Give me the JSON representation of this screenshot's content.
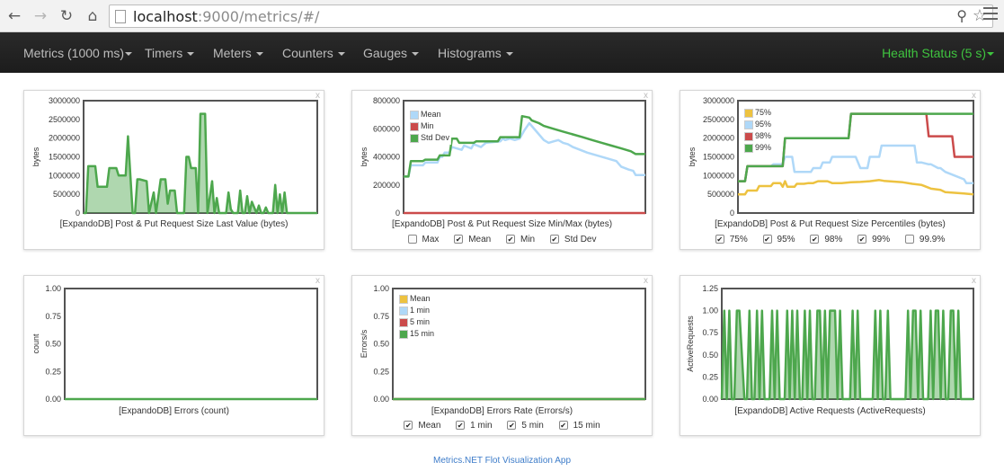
{
  "browser": {
    "back_icon": "back-arrow-icon",
    "forward_icon": "forward-arrow-icon",
    "reload_icon": "reload-icon",
    "home_icon": "home-icon",
    "url_host": "localhost",
    "url_rest": ":9000/metrics/#/",
    "zoom_icon": "zoom-icon",
    "star_icon": "bookmark-star-icon",
    "menu_icon": "menu-icon"
  },
  "navbar": {
    "items": [
      {
        "label": "Metrics (1000 ms)"
      },
      {
        "label": "Timers"
      },
      {
        "label": "Meters"
      },
      {
        "label": "Counters"
      },
      {
        "label": "Gauges"
      },
      {
        "label": "Histograms"
      }
    ],
    "health_label": "Health Status (5 s)",
    "health_color": "#3fc43f",
    "background": "#222222"
  },
  "panels": [
    {
      "close_label": "x",
      "caption": "[ExpandoDB] Post & Put Request Size Last Value (bytes)",
      "ylabel": "bytes",
      "legend": [],
      "toggles": []
    },
    {
      "close_label": "x",
      "caption": "[ExpandoDB] Post & Put Request Size Min/Max (bytes)",
      "ylabel": "bytes",
      "legend": [
        {
          "label": "Mean",
          "color": "#afd8f8"
        },
        {
          "label": "Min",
          "color": "#cb4b4b"
        },
        {
          "label": "Std Dev",
          "color": "#4da74d"
        }
      ],
      "toggles": [
        {
          "label": "Max",
          "checked": false
        },
        {
          "label": "Mean",
          "checked": true
        },
        {
          "label": "Min",
          "checked": true
        },
        {
          "label": "Std Dev",
          "checked": true
        }
      ]
    },
    {
      "close_label": "x",
      "caption": "[ExpandoDB] Post & Put Request Size Percentiles (bytes)",
      "ylabel": "bytes",
      "legend": [
        {
          "label": "75%",
          "color": "#edc240"
        },
        {
          "label": "95%",
          "color": "#afd8f8"
        },
        {
          "label": "98%",
          "color": "#cb4b4b"
        },
        {
          "label": "99%",
          "color": "#4da74d"
        }
      ],
      "toggles": [
        {
          "label": "75%",
          "checked": true
        },
        {
          "label": "95%",
          "checked": true
        },
        {
          "label": "98%",
          "checked": true
        },
        {
          "label": "99%",
          "checked": true
        },
        {
          "label": "99.9%",
          "checked": false
        }
      ]
    },
    {
      "close_label": "x",
      "caption": "[ExpandoDB] Errors (count)",
      "ylabel": "count",
      "legend": [],
      "toggles": []
    },
    {
      "close_label": "x",
      "caption": "[ExpandoDB] Errors Rate (Errors/s)",
      "ylabel": "Errors/s",
      "legend": [
        {
          "label": "Mean",
          "color": "#edc240"
        },
        {
          "label": "1 min",
          "color": "#afd8f8"
        },
        {
          "label": "5 min",
          "color": "#cb4b4b"
        },
        {
          "label": "15 min",
          "color": "#4da74d"
        }
      ],
      "toggles": [
        {
          "label": "Mean",
          "checked": true
        },
        {
          "label": "1 min",
          "checked": true
        },
        {
          "label": "5 min",
          "checked": true
        },
        {
          "label": "15 min",
          "checked": true
        }
      ]
    },
    {
      "close_label": "x",
      "caption": "[ExpandoDB] Active Requests (ActiveRequests)",
      "ylabel": "ActiveRequests",
      "legend": [],
      "toggles": []
    }
  ],
  "chart_data": [
    {
      "type": "area",
      "title": "[ExpandoDB] Post & Put Request Size Last Value (bytes)",
      "ylabel": "bytes",
      "ylim": [
        0,
        3000000
      ],
      "yticks": [
        "0",
        "500000",
        "1000000",
        "1500000",
        "2000000",
        "2500000",
        "3000000"
      ],
      "xlim": [
        0,
        100
      ],
      "series": [
        {
          "color": "#4da74d",
          "fill": true,
          "x": [
            0,
            1,
            2,
            5,
            6,
            10,
            11,
            14,
            15,
            18,
            19,
            21,
            22,
            23,
            24,
            27,
            28,
            30,
            31,
            33,
            35,
            36,
            37,
            39,
            40,
            42,
            43,
            44,
            45,
            46,
            48,
            49,
            50,
            52,
            53,
            55,
            56,
            57,
            58,
            61,
            62,
            63,
            64,
            66,
            67,
            68,
            69,
            70,
            71,
            72,
            74,
            75,
            76,
            77,
            78,
            79,
            80,
            81,
            82,
            83,
            84,
            85,
            86,
            87,
            88,
            90,
            91,
            92,
            93,
            94,
            96,
            97,
            98,
            99,
            100
          ],
          "y": [
            0,
            0,
            1250000,
            1250000,
            700000,
            700000,
            1200000,
            1200000,
            1000000,
            1000000,
            2050000,
            0,
            0,
            900000,
            900000,
            850000,
            0,
            550000,
            0,
            900000,
            900000,
            250000,
            600000,
            600000,
            0,
            0,
            0,
            1500000,
            1500000,
            1200000,
            1200000,
            0,
            2650000,
            2650000,
            0,
            850000,
            0,
            400000,
            0,
            0,
            550000,
            100000,
            0,
            0,
            600000,
            0,
            0,
            450000,
            0,
            300000,
            0,
            200000,
            0,
            0,
            150000,
            0,
            0,
            0,
            750000,
            0,
            500000,
            0,
            550000,
            0,
            0,
            0,
            0,
            0,
            0,
            0,
            0,
            0,
            0,
            0,
            0
          ]
        }
      ]
    },
    {
      "type": "line",
      "title": "[ExpandoDB] Post & Put Request Size Min/Max (bytes)",
      "ylabel": "bytes",
      "ylim": [
        0,
        800000
      ],
      "yticks": [
        "0",
        "200000",
        "400000",
        "600000",
        "800000"
      ],
      "xlim": [
        0,
        100
      ],
      "series": [
        {
          "name": "Mean",
          "color": "#afd8f8",
          "x": [
            0,
            2,
            3,
            8,
            9,
            14,
            15,
            16,
            17,
            19,
            20,
            24,
            25,
            28,
            29,
            32,
            34,
            40,
            41,
            42,
            44,
            46,
            48,
            50,
            52,
            56,
            58,
            60,
            62,
            64,
            66,
            68,
            70,
            73,
            76,
            80,
            84,
            88,
            90,
            93,
            95,
            96,
            98,
            100
          ],
          "y": [
            260000,
            260000,
            340000,
            340000,
            360000,
            360000,
            400000,
            400000,
            430000,
            430000,
            470000,
            450000,
            480000,
            460000,
            490000,
            470000,
            500000,
            510000,
            530000,
            520000,
            530000,
            520000,
            530000,
            590000,
            640000,
            560000,
            520000,
            500000,
            510000,
            520000,
            500000,
            490000,
            470000,
            450000,
            430000,
            410000,
            390000,
            370000,
            330000,
            310000,
            300000,
            270000,
            270000,
            270000
          ]
        },
        {
          "name": "Min",
          "color": "#cb4b4b",
          "x": [
            0,
            100
          ],
          "y": [
            0,
            0
          ]
        },
        {
          "name": "Std Dev",
          "color": "#4da74d",
          "x": [
            0,
            2,
            3,
            8,
            9,
            14,
            15,
            19,
            20,
            22,
            23,
            29,
            30,
            39,
            40,
            48,
            49,
            52,
            53,
            56,
            58,
            62,
            66,
            70,
            74,
            78,
            82,
            86,
            90,
            94,
            96,
            100
          ],
          "y": [
            260000,
            260000,
            370000,
            370000,
            380000,
            380000,
            410000,
            410000,
            530000,
            530000,
            500000,
            500000,
            510000,
            510000,
            540000,
            540000,
            690000,
            680000,
            660000,
            640000,
            620000,
            600000,
            580000,
            560000,
            540000,
            520000,
            500000,
            480000,
            460000,
            440000,
            420000,
            420000
          ]
        }
      ]
    },
    {
      "type": "line",
      "title": "[ExpandoDB] Post & Put Request Size Percentiles (bytes)",
      "ylabel": "bytes",
      "ylim": [
        0,
        3000000
      ],
      "yticks": [
        "0",
        "500000",
        "1000000",
        "1500000",
        "2000000",
        "2500000",
        "3000000"
      ],
      "xlim": [
        0,
        100
      ],
      "series": [
        {
          "name": "75%",
          "color": "#edc240",
          "x": [
            0,
            3,
            4,
            8,
            9,
            14,
            15,
            18,
            19,
            20,
            21,
            24,
            25,
            28,
            30,
            32,
            34,
            38,
            40,
            44,
            48,
            52,
            56,
            60,
            62,
            66,
            70,
            74,
            78,
            80,
            82,
            86,
            88,
            92,
            96,
            100
          ],
          "y": [
            500000,
            500000,
            600000,
            600000,
            720000,
            720000,
            800000,
            800000,
            700000,
            850000,
            700000,
            700000,
            780000,
            780000,
            800000,
            800000,
            850000,
            850000,
            800000,
            800000,
            820000,
            830000,
            850000,
            880000,
            860000,
            840000,
            820000,
            780000,
            750000,
            700000,
            650000,
            620000,
            560000,
            540000,
            520000,
            500000
          ]
        },
        {
          "name": "95%",
          "color": "#afd8f8",
          "x": [
            0,
            3,
            4,
            14,
            15,
            19,
            20,
            23,
            24,
            31,
            32,
            35,
            36,
            39,
            40,
            48,
            50,
            52,
            55,
            56,
            60,
            61,
            75,
            76,
            78,
            81,
            82,
            85,
            86,
            88,
            92,
            96,
            97,
            100
          ],
          "y": [
            850000,
            850000,
            1250000,
            1250000,
            1300000,
            1300000,
            1500000,
            1500000,
            1100000,
            1100000,
            1200000,
            1200000,
            1350000,
            1350000,
            1500000,
            1500000,
            1500000,
            1200000,
            1200000,
            1500000,
            1500000,
            1800000,
            1800000,
            1350000,
            1350000,
            1300000,
            1300000,
            1200000,
            1200000,
            1100000,
            1000000,
            900000,
            800000,
            800000
          ]
        },
        {
          "name": "98%",
          "color": "#cb4b4b",
          "x": [
            0,
            3,
            4,
            19,
            20,
            47,
            48,
            80,
            81,
            91,
            92,
            100
          ],
          "y": [
            850000,
            850000,
            1250000,
            1250000,
            2000000,
            2000000,
            2650000,
            2650000,
            2050000,
            2050000,
            1500000,
            1500000
          ]
        },
        {
          "name": "99%",
          "color": "#4da74d",
          "x": [
            0,
            3,
            4,
            19,
            20,
            47,
            48,
            100
          ],
          "y": [
            850000,
            850000,
            1250000,
            1250000,
            2000000,
            2000000,
            2650000,
            2650000
          ]
        }
      ]
    },
    {
      "type": "line",
      "title": "[ExpandoDB] Errors (count)",
      "ylabel": "count",
      "ylim": [
        0,
        1
      ],
      "yticks": [
        "0.00",
        "0.25",
        "0.50",
        "0.75",
        "1.00"
      ],
      "xlim": [
        0,
        100
      ],
      "series": [
        {
          "color": "#4da74d",
          "x": [
            0,
            100
          ],
          "y": [
            0,
            0
          ]
        }
      ]
    },
    {
      "type": "line",
      "title": "[ExpandoDB] Errors Rate (Errors/s)",
      "ylabel": "Errors/s",
      "ylim": [
        0,
        1
      ],
      "yticks": [
        "0.00",
        "0.25",
        "0.50",
        "0.75",
        "1.00"
      ],
      "xlim": [
        0,
        100
      ],
      "series": [
        {
          "name": "Mean",
          "color": "#edc240",
          "x": [
            0,
            100
          ],
          "y": [
            0,
            0
          ]
        },
        {
          "name": "1 min",
          "color": "#afd8f8",
          "x": [
            0,
            100
          ],
          "y": [
            0,
            0
          ]
        },
        {
          "name": "5 min",
          "color": "#cb4b4b",
          "x": [
            0,
            100
          ],
          "y": [
            0,
            0
          ]
        },
        {
          "name": "15 min",
          "color": "#4da74d",
          "x": [
            0,
            100
          ],
          "y": [
            0,
            0
          ]
        }
      ]
    },
    {
      "type": "area",
      "title": "[ExpandoDB] Active Requests (ActiveRequests)",
      "ylabel": "ActiveRequests",
      "ylim": [
        0,
        1.25
      ],
      "yticks": [
        "0.00",
        "0.25",
        "0.50",
        "0.75",
        "1.00",
        "1.25"
      ],
      "xlim": [
        0,
        100
      ],
      "series": [
        {
          "color": "#4da74d",
          "fill": true,
          "x": [
            0,
            1,
            2,
            3,
            4,
            5,
            6,
            7,
            9,
            10,
            11,
            12,
            13,
            14,
            15,
            16,
            17,
            19,
            20,
            21,
            22,
            23,
            24,
            25,
            26,
            27,
            28,
            29,
            30,
            31,
            32,
            33,
            34,
            35,
            36,
            37,
            38,
            39,
            40,
            41,
            42,
            43,
            45,
            46,
            47,
            48,
            49,
            50,
            51,
            52,
            53,
            54,
            55,
            56,
            57,
            58,
            59,
            60,
            61,
            62,
            63,
            64,
            65,
            66,
            67,
            68,
            69,
            70,
            71,
            72,
            73,
            74,
            75,
            76,
            77,
            78,
            79,
            80,
            81,
            82,
            83,
            84,
            85,
            86,
            87,
            88,
            89,
            90,
            91,
            92,
            93,
            94,
            95,
            96,
            97,
            98,
            99,
            100
          ],
          "y": [
            0,
            1,
            0,
            1,
            0,
            0,
            1,
            1,
            0,
            0,
            1,
            0,
            0,
            1,
            0,
            1,
            0,
            0,
            1,
            0,
            1,
            0,
            0,
            0,
            1,
            0,
            1,
            0,
            1,
            0,
            0,
            1,
            0,
            1,
            0,
            0,
            1,
            1,
            0,
            1,
            0,
            1,
            1,
            0,
            1,
            0,
            0,
            0,
            0,
            1,
            0,
            1,
            0,
            0,
            0,
            0,
            0,
            0,
            1,
            0,
            1,
            0,
            0,
            1,
            0,
            0,
            0,
            0,
            0,
            0,
            0,
            1,
            0,
            1,
            1,
            0,
            1,
            0,
            0,
            0,
            1,
            0,
            1,
            1,
            0,
            1,
            0,
            0,
            1,
            1,
            0,
            1,
            0,
            0,
            0,
            0,
            0,
            0
          ]
        }
      ]
    }
  ],
  "footer": {
    "text": "Metrics.NET Flot Visualization App"
  }
}
